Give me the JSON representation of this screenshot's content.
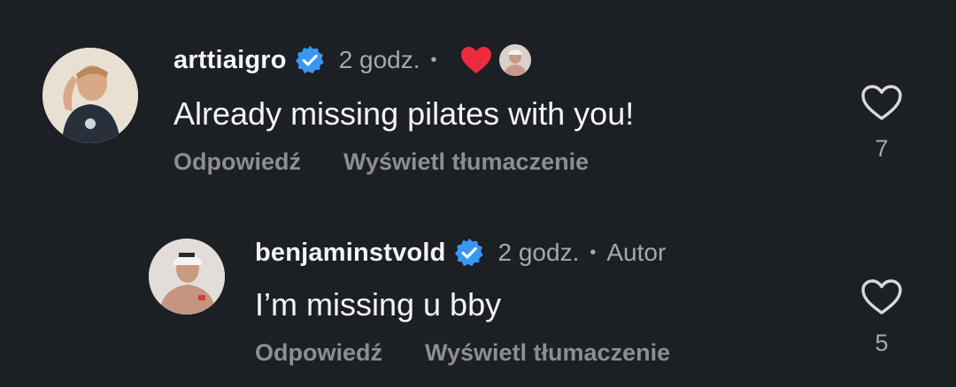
{
  "comments": [
    {
      "username": "arttiaigro",
      "time": "2 godz.",
      "separator": "•",
      "text": "Already missing pilates with you!",
      "reply_label": "Odpowiedź",
      "translate_label": "Wyświetl tłumaczenie",
      "likes": "7",
      "liked_by_author_icon": "heart-icon",
      "verified": true
    },
    {
      "username": "benjaminstvold",
      "time": "2 godz.",
      "separator": "•",
      "author_badge": "Autor",
      "text": "I’m missing u bby",
      "reply_label": "Odpowiedź",
      "translate_label": "Wyświetl tłumaczenie",
      "likes": "5",
      "verified": true
    }
  ],
  "colors": {
    "background": "#1c1f24",
    "verified": "#3897f0",
    "heart": "#ed2b3f",
    "secondary_text": "#a8a8a8"
  }
}
